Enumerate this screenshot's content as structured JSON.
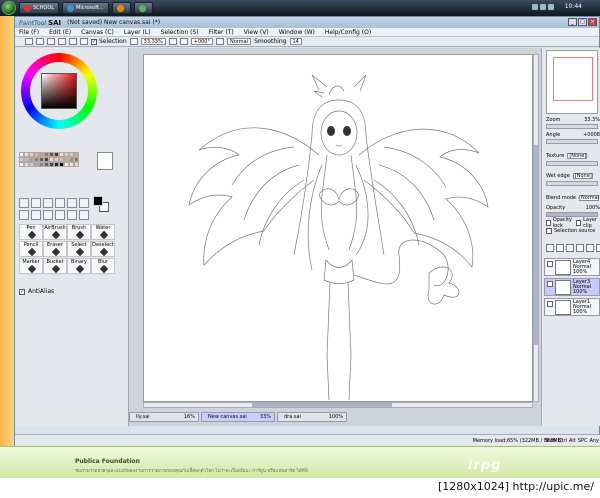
{
  "taskbar": {
    "buttons": [
      "SCHOOL",
      "Microsoft..."
    ],
    "clock": "10:44"
  },
  "window": {
    "logo_prefix": "PaintTool",
    "logo_name": "SAI",
    "title": "(Not saved) New canvas.sai (*)"
  },
  "menu": [
    "File (F)",
    "Edit (E)",
    "Canvas (C)",
    "Layer (L)",
    "Selection (S)",
    "Filter (T)",
    "View (V)",
    "Window (W)",
    "Help/Config (O)"
  ],
  "toolbar": {
    "selection_label": "Selection",
    "zoom": "33.33%",
    "rotation": "+000°",
    "blend": "Normal",
    "smoothing_label": "Smoothing",
    "smoothing_value": "14"
  },
  "tools": {
    "brushes": [
      {
        "label": "Pen"
      },
      {
        "label": "AirBrush"
      },
      {
        "label": "Brush"
      },
      {
        "label": "Water"
      },
      {
        "label": "Pencil"
      },
      {
        "label": "Eraser"
      },
      {
        "label": "Select"
      },
      {
        "label": "Deselect"
      },
      {
        "label": "Marker"
      },
      {
        "label": "Bucket"
      },
      {
        "label": "Binary"
      },
      {
        "label": "Blur"
      }
    ],
    "antialias_label": "AntiAlias"
  },
  "swatch_colors": [
    "#ffffff",
    "#f2e6d9",
    "#e8d1bf",
    "#d9b89c",
    "#c99c7a",
    "#a87350",
    "#7a4f35",
    "#4d2f1f",
    "#fbe2d8",
    "#f4c4b0",
    "#eac9a7",
    "#cfa785",
    "#e2c8b8",
    "#d8b49e",
    "#c89a80",
    "#a5775b",
    "#805640",
    "#5d3a28",
    "#ffd9d9",
    "#ffc2c2",
    "#efb6a0",
    "#d9a08a",
    "#b98873",
    "#96705f",
    "#efefef",
    "#dddddd",
    "#cccccc",
    "#aaaaaa",
    "#888888",
    "#666666",
    "#444444",
    "#222222",
    "#000000",
    "#fff4e0",
    "#ffe7c2",
    "#ffd89e"
  ],
  "right_panel": {
    "zoom_label": "Zoom",
    "zoom_value": "33.3%",
    "angle_label": "Angle",
    "angle_value": "+0008",
    "texture_label": "Texture",
    "texture_value": "[None]",
    "wet_edge_label": "Wet edge",
    "wet_edge_value": "[None]",
    "blend_mode_label": "Blend mode",
    "blend_mode_value": "Normal",
    "opacity_label": "Opacity",
    "opacity_value": "100%",
    "opacity_lock": "Opacity lock",
    "layer_clip": "Layer clip",
    "selection_source": "Selection source"
  },
  "layers": [
    {
      "name": "Layer4",
      "mode": "Normal",
      "opacity": "100%",
      "selected": false
    },
    {
      "name": "Layer3",
      "mode": "Normal",
      "opacity": "100%",
      "selected": true
    },
    {
      "name": "Layer1",
      "mode": "Normal",
      "opacity": "100%",
      "selected": false
    }
  ],
  "doc_tabs": [
    {
      "name": "lly.sai",
      "pct": "16%",
      "active": false
    },
    {
      "name": "New canvas.sai",
      "pct": "33%",
      "active": true
    },
    {
      "name": "dra.sai",
      "pct": "100%",
      "active": false
    }
  ],
  "status": {
    "memory": "Memory load:65% (322MB / 863MB)",
    "keys": [
      "Shift",
      "Ctrl",
      "Alt",
      "SPC",
      "Any"
    ]
  },
  "banner": {
    "title": "Publica Foundation",
    "body": "ชมภาพวาดสวยๆและแบ่งปันผลงานการวาดภาพของคุณกับเพื่อนๆทั่วโลก ไม่ว่าจะเป็นอนิเมะ การ์ตูน หรือแฟนอาร์ต ได้ที่นี่",
    "logo": "irpg"
  },
  "watermark": "[1280x1024] http://upic.me/",
  "colors": {
    "canvas_bg": "#cdd3db",
    "panel_bg": "#e4e8ec",
    "selected_layer": "#c7c9f8",
    "banner_green": "#cfe8a4"
  }
}
